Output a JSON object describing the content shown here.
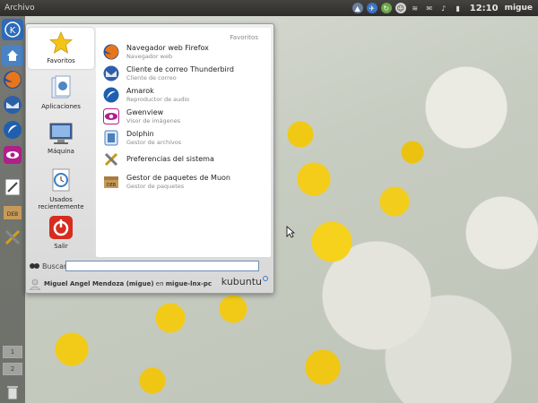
{
  "top_panel": {
    "title": "Archivo",
    "clock": "12:10",
    "user": "migue",
    "tray_icons": [
      "arrow-up-icon",
      "network-plane-icon",
      "update-icon",
      "alien-icon",
      "wifi-icon",
      "mail-icon",
      "volume-icon",
      "battery-icon"
    ]
  },
  "launcher": {
    "items": [
      "kde-logo-icon",
      "home-icon",
      "firefox-icon",
      "thunderbird-icon",
      "amarok-icon",
      "gwenview-icon",
      "text-editor-icon",
      "deb-package-icon",
      "system-tools-icon"
    ],
    "workspaces": [
      "1",
      "2"
    ],
    "trash": "trash-icon"
  },
  "menu": {
    "sidebar": [
      {
        "label": "Favoritos",
        "icon": "star-icon"
      },
      {
        "label": "Aplicaciones",
        "icon": "applications-icon"
      },
      {
        "label": "Máquina",
        "icon": "computer-icon"
      },
      {
        "label": "Usados recientemente",
        "icon": "clock-document-icon"
      },
      {
        "label": "Salir",
        "icon": "power-icon"
      }
    ],
    "favorites_title": "Favoritos",
    "favorites": [
      {
        "name": "Navegador web Firefox",
        "desc": "Navegador web",
        "icon": "firefox-icon"
      },
      {
        "name": "Cliente de correo Thunderbird",
        "desc": "Cliente de correo",
        "icon": "thunderbird-icon"
      },
      {
        "name": "Amarok",
        "desc": "Reproductor de audio",
        "icon": "amarok-icon"
      },
      {
        "name": "Gwenview",
        "desc": "Visor de imágenes",
        "icon": "gwenview-icon"
      },
      {
        "name": "Dolphin",
        "desc": "Gestor de archivos",
        "icon": "dolphin-icon"
      },
      {
        "name": "Preferencias del sistema",
        "desc": "",
        "icon": "system-settings-icon"
      },
      {
        "name": "Gestor de paquetes de Muon",
        "desc": "Gestor de paquetes",
        "icon": "muon-package-icon"
      }
    ],
    "search_label": "Buscar:",
    "search_value": "",
    "user_name": "Miguel Angel Mendoza (migue)",
    "user_conn": "en",
    "host": "migue-lnx-pc",
    "brand": "kubuntu",
    "colors": {
      "accent": "#3a7dc8",
      "panel": "#353432"
    }
  }
}
